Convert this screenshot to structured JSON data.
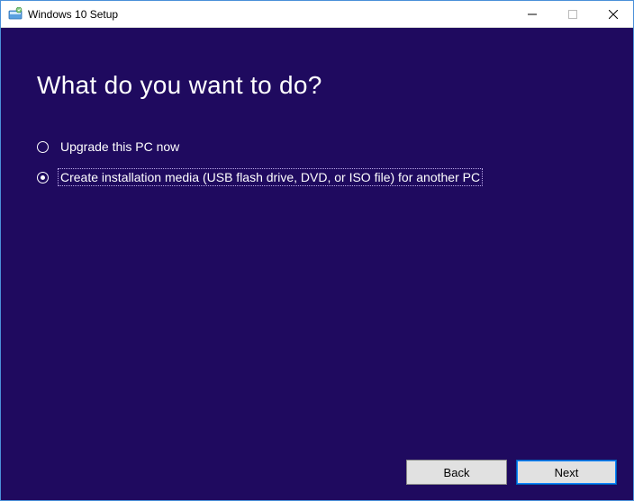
{
  "window": {
    "title": "Windows 10 Setup"
  },
  "content": {
    "heading": "What do you want to do?",
    "options": [
      {
        "label": "Upgrade this PC now",
        "selected": false
      },
      {
        "label": "Create installation media (USB flash drive, DVD, or ISO file) for another PC",
        "selected": true
      }
    ]
  },
  "footer": {
    "back": "Back",
    "next": "Next"
  },
  "colors": {
    "background": "#1f0a5f",
    "accent": "#0a84ff"
  }
}
